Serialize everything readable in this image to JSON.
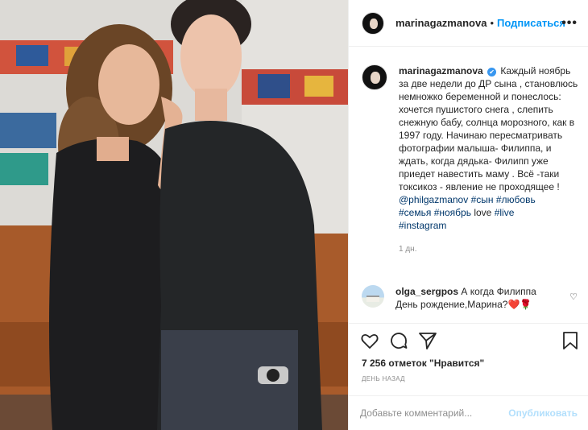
{
  "post": {
    "photo_icon": "photo-people",
    "author": {
      "username": "marinagazmanova",
      "follow_label": "Подписаться",
      "separator": "•",
      "more_icon": "ellipsis-icon",
      "more_label": "•••",
      "verified_icon": "verified-badge-icon",
      "verified_label": "✔"
    },
    "caption": {
      "username": "marinagazmanova",
      "text": "Каждый ноябрь за две недели до ДР сына , становлюсь немножко беременной и понеслось: хочется пушистого снега , слепить снежную бабу, солнца морозного, как в 1997 году. Начинаю пересматривать фотографии малыша- Филиппа, и ждать, когда дядька- Филипп уже приедет навестить маму . Всё -таки токсикоз - явление не проходящее !",
      "mention": "@philgazmanov",
      "tags_line1": [
        "#сын",
        "#любовь"
      ],
      "tags_line2_a": "#семья",
      "tags_line2_b": "#ноябрь",
      "plain_word": "love",
      "tags_line2_c": "#live",
      "tags_line3": "#instagram",
      "age": "1 дн."
    },
    "comment": {
      "username": "olga_sergpos",
      "text": "А когда Филиппа День рождение,Марина?",
      "emoji": "❤️🌹",
      "like_icon": "heart-outline-icon",
      "like_label": "♡"
    },
    "actions": {
      "like_icon": "heart-icon",
      "comment_icon": "comment-bubble-icon",
      "share_icon": "share-plane-icon",
      "save_icon": "bookmark-icon"
    },
    "likes_text": "7 256 отметок \"Нравится\"",
    "date_text": "ДЕНЬ НАЗАД",
    "comment_input": {
      "placeholder": "Добавьте комментарий...",
      "post_label": "Опубликовать"
    },
    "colors": {
      "accent": "#0095f6",
      "link": "#00376b",
      "muted": "#8e8e8e",
      "border": "#efefef"
    }
  }
}
